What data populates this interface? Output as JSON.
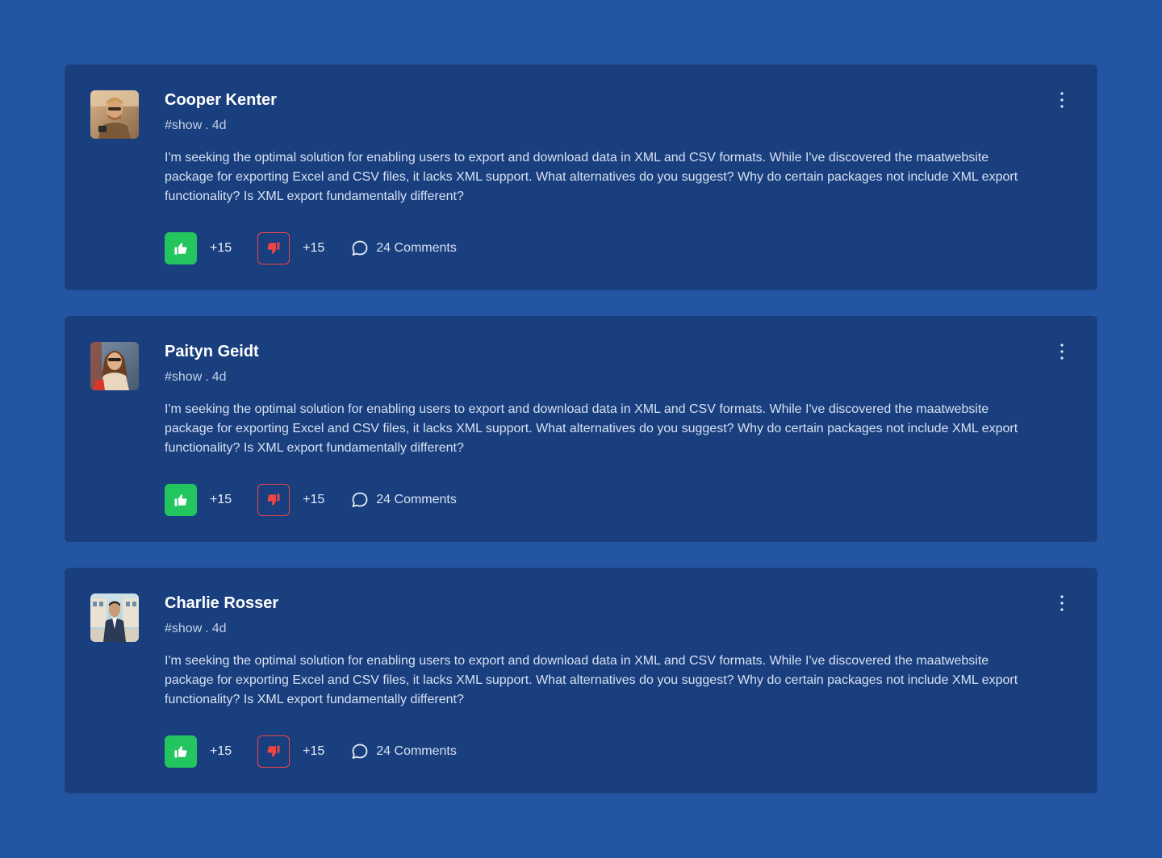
{
  "colors": {
    "page_background": "#2355a3",
    "card_background": "#1a3f7e",
    "like_accent": "#22c55e",
    "dislike_accent": "#ef4444"
  },
  "posts": [
    {
      "author": "Cooper Kenter",
      "tag": "#show",
      "time": "4d",
      "body": "I'm seeking the optimal solution for enabling users to export and download data in XML and CSV formats. While I've discovered the maatwebsite package for exporting Excel and CSV files, it lacks XML support. What alternatives do you suggest? Why do certain packages not include XML export functionality? Is XML export fundamentally different?",
      "likes": "+15",
      "dislikes": "+15",
      "comments": "24 Comments",
      "avatar_icon": "avatar-photo"
    },
    {
      "author": "Paityn Geidt",
      "tag": "#show",
      "time": "4d",
      "body": "I'm seeking the optimal solution for enabling users to export and download data in XML and CSV formats. While I've discovered the maatwebsite package for exporting Excel and CSV files, it lacks XML support. What alternatives do you suggest? Why do certain packages not include XML export functionality? Is XML export fundamentally different?",
      "likes": "+15",
      "dislikes": "+15",
      "comments": "24 Comments",
      "avatar_icon": "avatar-photo"
    },
    {
      "author": "Charlie Rosser",
      "tag": "#show",
      "time": "4d",
      "body": "I'm seeking the optimal solution for enabling users to export and download data in XML and CSV formats. While I've discovered the maatwebsite package for exporting Excel and CSV files, it lacks XML support. What alternatives do you suggest? Why do certain packages not include XML export functionality? Is XML export fundamentally different?",
      "likes": "+15",
      "dislikes": "+15",
      "comments": "24 Comments",
      "avatar_icon": "avatar-photo"
    }
  ],
  "icons": {
    "like": "thumbs-up-icon",
    "dislike": "thumbs-down-icon",
    "comment": "comment-bubble-icon",
    "menu": "more-vertical-icon"
  }
}
